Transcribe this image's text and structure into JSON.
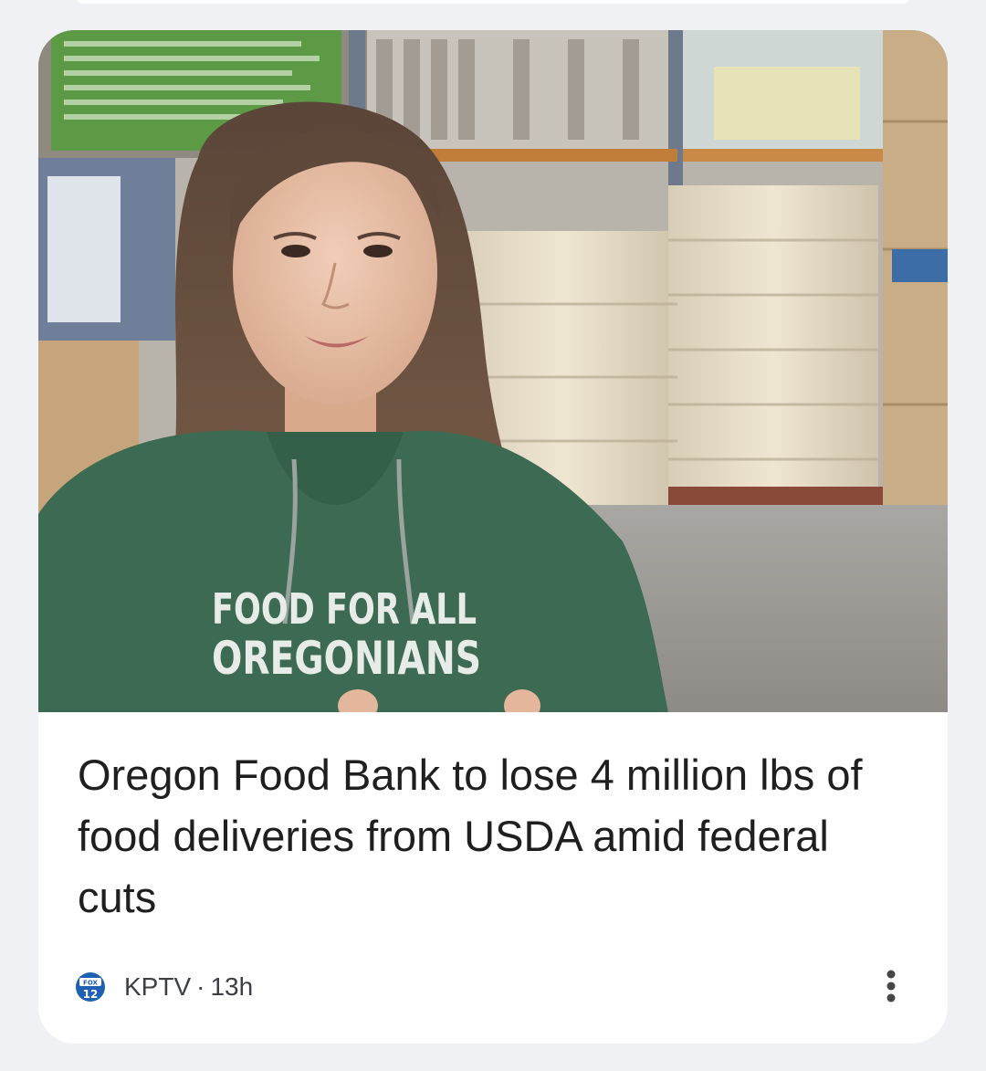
{
  "article": {
    "headline": "Oregon Food Bank to lose 4 million lbs of food deliveries from USDA amid federal cuts",
    "source": "KPTV",
    "separator": "·",
    "age": "13h",
    "source_logo_text": "FOX 12",
    "image_hoodie_line1": "FOOD FOR ALL",
    "image_hoodie_line2": "OREGONIANS"
  },
  "icons": {
    "source_logo": "fox12-logo-icon",
    "more": "more-vert-icon"
  },
  "colors": {
    "page_background": "#f0f1f4",
    "card_background": "#ffffff",
    "headline_text": "#1f1f1f",
    "meta_text": "#3c4043",
    "logo_blue": "#1f5fb4",
    "hoodie_green": "#3c6a52"
  }
}
